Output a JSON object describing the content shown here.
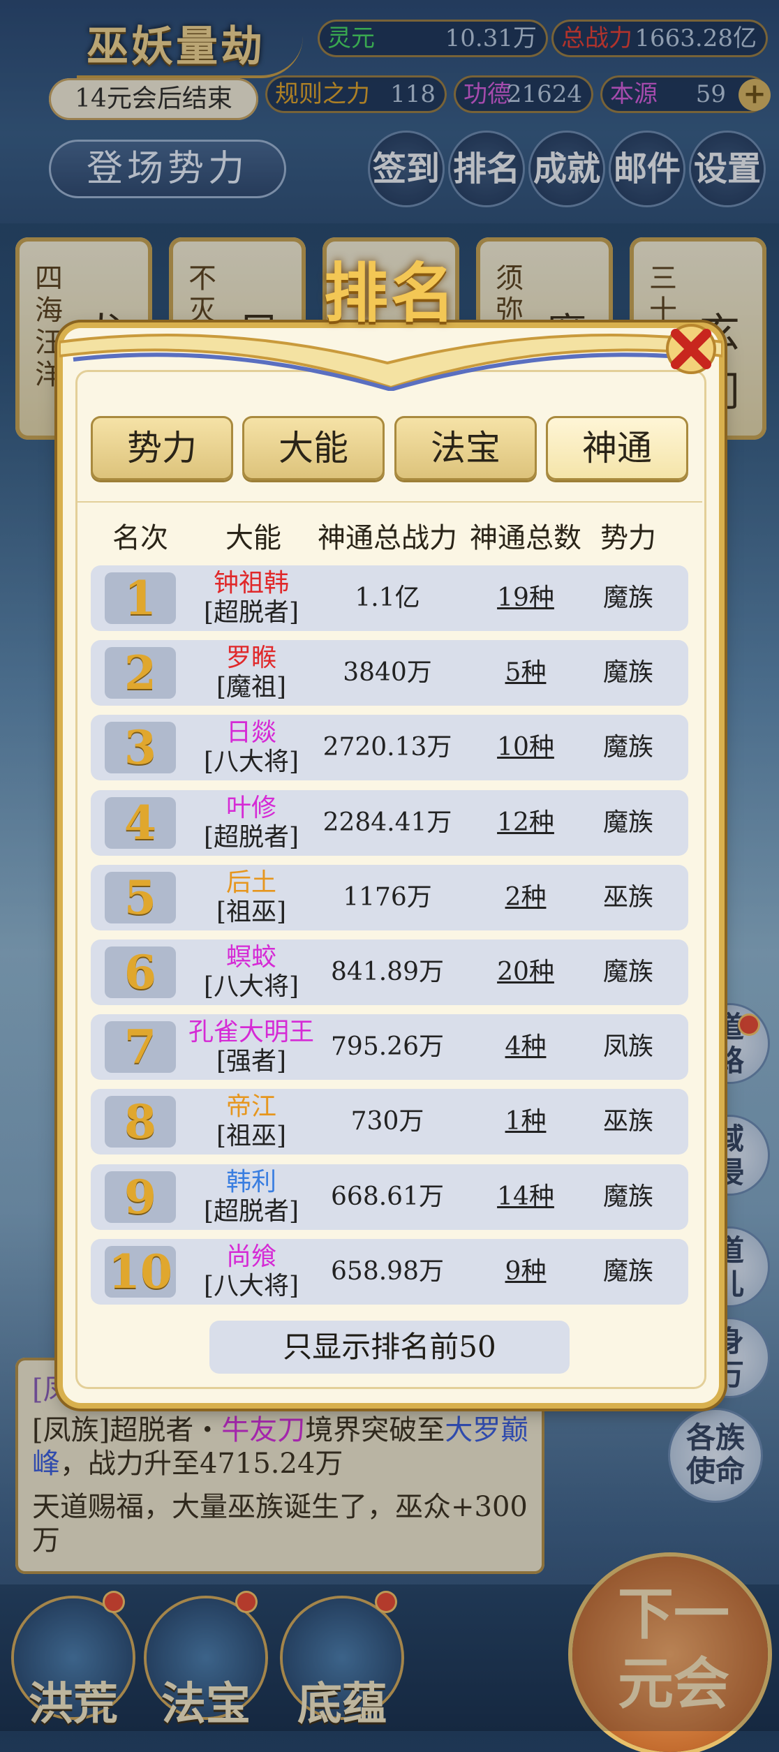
{
  "header": {
    "game_title": "巫妖量劫",
    "era_text": "14元会后结束",
    "resources": {
      "lingyuan": {
        "label": "灵元",
        "value": "10.31万"
      },
      "power": {
        "label": "总战力",
        "value": "1663.28亿"
      },
      "rule": {
        "label": "规则之力",
        "value": "118"
      },
      "merit": {
        "label": "功德",
        "value": "21624"
      },
      "origin": {
        "label": "本源",
        "value": "59"
      }
    },
    "add_symbol": "+",
    "stage_button": "登场势力",
    "menu": [
      {
        "label": "签到"
      },
      {
        "label": "排名"
      },
      {
        "label": "成就"
      },
      {
        "label": "邮件"
      },
      {
        "label": "设置"
      }
    ]
  },
  "factions": [
    {
      "vertical": "四海汪洋",
      "big": "龙"
    },
    {
      "vertical": "不灭",
      "big": "凤"
    },
    {
      "vertical": "",
      "big": ""
    },
    {
      "vertical": "须弥",
      "big": "魔"
    },
    {
      "vertical": "三十",
      "big": "玄门"
    }
  ],
  "dialog": {
    "title": "排名",
    "tabs": [
      "势力",
      "大能",
      "法宝",
      "神通"
    ],
    "active_tab": "神通",
    "headers": [
      "名次",
      "大能",
      "神通总战力",
      "神通总数",
      "势力"
    ],
    "rows": [
      {
        "rank": "1",
        "name": "钟祖韩",
        "name_color": "#e0282a",
        "title": "[超脱者]",
        "power": "1.1亿",
        "count": "19种",
        "faction": "魔族"
      },
      {
        "rank": "2",
        "name": "罗睺",
        "name_color": "#e0282a",
        "title": "[魔祖]",
        "power": "3840万",
        "count": "5种",
        "faction": "魔族"
      },
      {
        "rank": "3",
        "name": "日燚",
        "name_color": "#d52ad5",
        "title": "[八大将]",
        "power": "2720.13万",
        "count": "10种",
        "faction": "魔族"
      },
      {
        "rank": "4",
        "name": "叶修",
        "name_color": "#d52ad5",
        "title": "[超脱者]",
        "power": "2284.41万",
        "count": "12种",
        "faction": "魔族"
      },
      {
        "rank": "5",
        "name": "后土",
        "name_color": "#e6961e",
        "title": "[祖巫]",
        "power": "1176万",
        "count": "2种",
        "faction": "巫族"
      },
      {
        "rank": "6",
        "name": "螟蛟",
        "name_color": "#d52ad5",
        "title": "[八大将]",
        "power": "841.89万",
        "count": "20种",
        "faction": "魔族"
      },
      {
        "rank": "7",
        "name": "孔雀大明王",
        "name_color": "#d52ad5",
        "title": "[强者]",
        "power": "795.26万",
        "count": "4种",
        "faction": "凤族"
      },
      {
        "rank": "8",
        "name": "帝江",
        "name_color": "#e6961e",
        "title": "[祖巫]",
        "power": "730万",
        "count": "1种",
        "faction": "巫族"
      },
      {
        "rank": "9",
        "name": "韩利",
        "name_color": "#3a7ee0",
        "title": "[超脱者]",
        "power": "668.61万",
        "count": "14种",
        "faction": "魔族"
      },
      {
        "rank": "10",
        "name": "尚飨",
        "name_color": "#d52ad5",
        "title": "[八大将]",
        "power": "658.98万",
        "count": "9种",
        "faction": "魔族"
      }
    ],
    "show_top_button": "只显示排名前50"
  },
  "side_buttons": [
    {
      "label": "道路"
    },
    {
      "label": "域侵"
    },
    {
      "label": "道儿"
    },
    {
      "label": "身万"
    },
    {
      "label": "各族使命"
    }
  ],
  "news": {
    "partial_top": "[凤",
    "line1_prefix": "[凤族]超脱者・",
    "line1_name": "牛友刀",
    "line1_mid": "境界突破至",
    "line1_realm": "大罗巅峰",
    "line1_suffix": "，战力升至4715.24万",
    "line2": "天道赐福，大量巫族诞生了，巫众+300万"
  },
  "bottom": {
    "buttons": [
      "洪荒",
      "法宝",
      "底蕴"
    ],
    "next_button": "下一元会"
  },
  "colors": {
    "gold": "#f3c755",
    "row_bg": "#d9deea",
    "dialog_bg": "#fbf6e4",
    "red_name": "#e0282a",
    "purple_name": "#d52ad5",
    "orange_name": "#e6961e",
    "blue_name": "#3a7ee0"
  }
}
